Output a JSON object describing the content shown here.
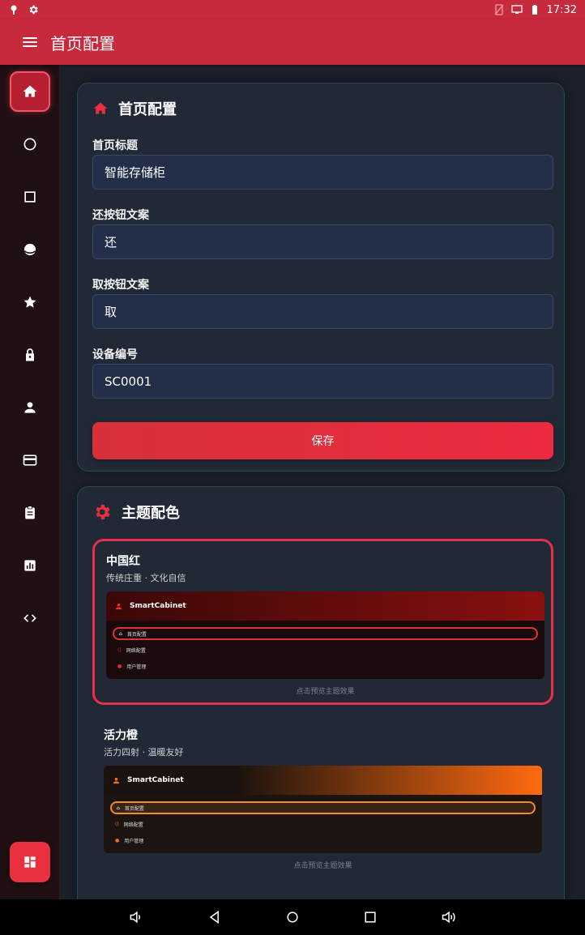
{
  "status_bar": {
    "time": "17:32"
  },
  "app_bar": {
    "title": "首页配置"
  },
  "sidebar": {
    "items": [
      {
        "icon": "home-icon"
      },
      {
        "icon": "circle-icon"
      },
      {
        "icon": "square-icon"
      },
      {
        "icon": "globe-icon"
      },
      {
        "icon": "star-icon"
      },
      {
        "icon": "lock-icon"
      },
      {
        "icon": "person-icon"
      },
      {
        "icon": "card-icon"
      },
      {
        "icon": "clipboard-icon"
      },
      {
        "icon": "chart-icon"
      },
      {
        "icon": "code-icon"
      }
    ],
    "fab_icon": "dashboard-icon"
  },
  "home_config": {
    "title": "首页标题",
    "header": "首页配置",
    "fields": {
      "title_label": "首页标题",
      "title_value": "智能存储柜",
      "return_label": "还按钮文案",
      "return_value": "还",
      "take_label": "取按钮文案",
      "take_value": "取",
      "device_label": "设备编号",
      "device_value": "SC0001"
    },
    "save_label": "保存"
  },
  "theme_config": {
    "header": "主题配色",
    "themes": [
      {
        "name": "中国红",
        "desc": "传统庄重 · 文化自信",
        "brand": "SmartCabinet",
        "items": [
          "首页配置",
          "网络配置",
          "用户管理"
        ],
        "hint": "点击预览主题效果",
        "accent": "#e0303a"
      },
      {
        "name": "活力橙",
        "desc": "活力四射 · 温暖友好",
        "brand": "SmartCabinet",
        "items": [
          "首页配置",
          "网络配置",
          "用户管理"
        ],
        "hint": "点击预览主题效果",
        "accent": "#f07020"
      }
    ]
  },
  "colors": {
    "primary": "#c62a3c",
    "sidebar_bg": "#200f13",
    "main_bg": "#1c2029",
    "card_bg": "#222936",
    "input_bg": "#232f48"
  }
}
